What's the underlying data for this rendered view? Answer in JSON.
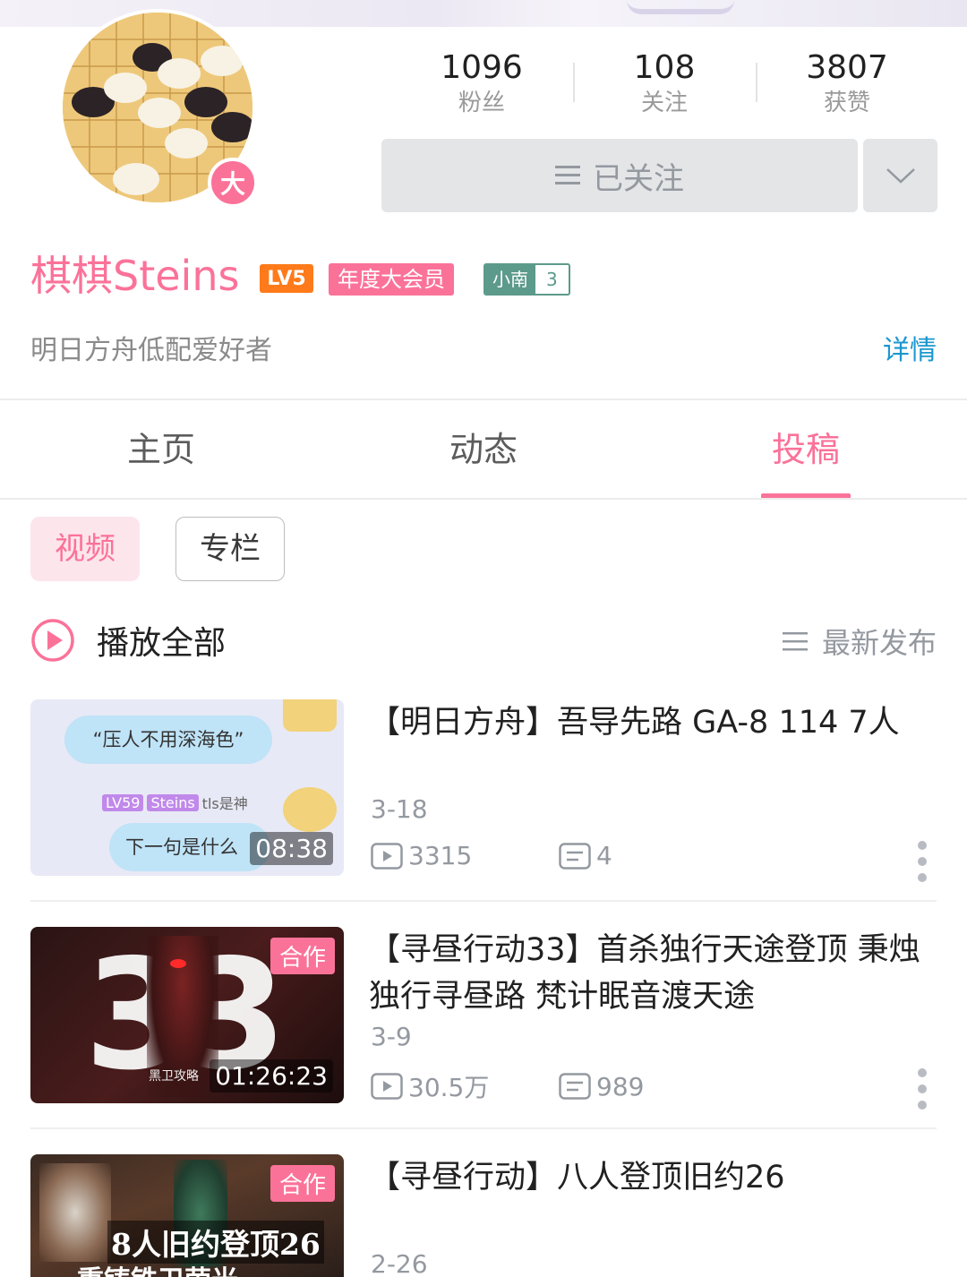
{
  "profile": {
    "avatar_badge": "大",
    "name": "棋棋Steins",
    "level_badge": "LV5",
    "vip_label": "年度大会员",
    "medal_name": "小南",
    "medal_level": "3",
    "bio": "明日方舟低配爱好者",
    "detail_link": "详情",
    "follow_label": "已关注"
  },
  "stats": [
    {
      "value": "1096",
      "label": "粉丝"
    },
    {
      "value": "108",
      "label": "关注"
    },
    {
      "value": "3807",
      "label": "获赞"
    }
  ],
  "tabs": [
    {
      "label": "主页"
    },
    {
      "label": "动态"
    },
    {
      "label": "投稿"
    }
  ],
  "subtabs": [
    {
      "label": "视频"
    },
    {
      "label": "专栏"
    }
  ],
  "toolbar": {
    "play_all": "播放全部",
    "sort": "最新发布"
  },
  "videos": [
    {
      "title": "【明日方舟】吾导先路 GA-8 114  7人",
      "date": "3-18",
      "views": "3315",
      "comments": "4",
      "duration": "08:38",
      "tag": "",
      "thumb_text_1": "“压人不用深海色”",
      "thumb_text_2": "下一句是什么",
      "thumb_tag_lv": "LV59",
      "thumb_tag_name": "Steins",
      "thumb_tag_note": "tls是神"
    },
    {
      "title": "【寻昼行动33】首杀独行天途登顶 秉烛独行寻昼路 梵计眠音渡天途",
      "date": "3-9",
      "views": "30.5万",
      "comments": "989",
      "duration": "01:26:23",
      "tag": "合作",
      "thumb_text": "33",
      "thumb_caption": "黑卫攻略"
    },
    {
      "title": "【寻昼行动】八人登顶旧约26",
      "date": "2-26",
      "views": "",
      "comments": "",
      "duration": "",
      "tag": "合作",
      "thumb_text_1": "8人旧约登顶26",
      "thumb_text_2": "重铸铁卫荣光"
    }
  ],
  "colors": {
    "accent": "#fb7299",
    "link": "#1a97d0",
    "muted": "#9499a0"
  }
}
